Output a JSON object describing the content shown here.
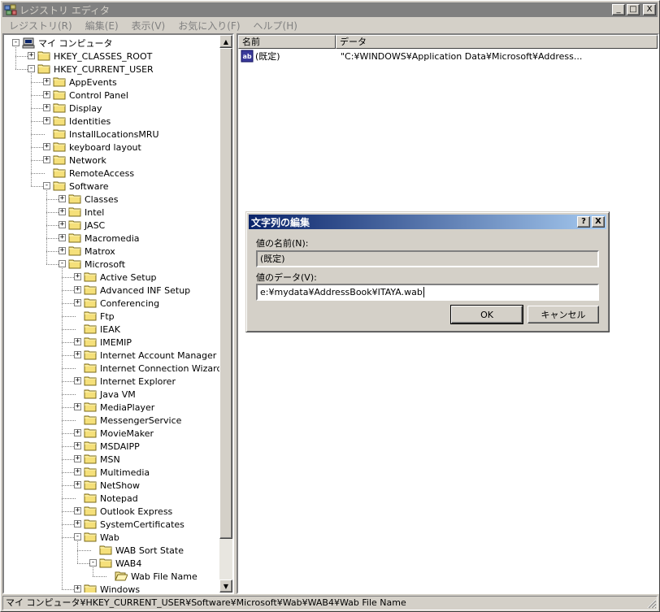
{
  "window": {
    "title": "レジストリ エディタ",
    "caption_minimize": "_",
    "caption_maximize": "□",
    "caption_close": "X"
  },
  "menu": [
    "レジストリ(R)",
    "編集(E)",
    "表示(V)",
    "お気に入り(F)",
    "ヘルプ(H)"
  ],
  "tree": {
    "root": "マイ コンピュータ",
    "nodes": [
      {
        "label": "HKEY_CLASSES_ROOT",
        "level": 1,
        "toggle": "+"
      },
      {
        "label": "HKEY_CURRENT_USER",
        "level": 1,
        "toggle": "-"
      },
      {
        "label": "AppEvents",
        "level": 2,
        "toggle": "+"
      },
      {
        "label": "Control Panel",
        "level": 2,
        "toggle": "+"
      },
      {
        "label": "Display",
        "level": 2,
        "toggle": "+"
      },
      {
        "label": "Identities",
        "level": 2,
        "toggle": "+"
      },
      {
        "label": "InstallLocationsMRU",
        "level": 2,
        "toggle": ""
      },
      {
        "label": "keyboard layout",
        "level": 2,
        "toggle": "+"
      },
      {
        "label": "Network",
        "level": 2,
        "toggle": "+"
      },
      {
        "label": "RemoteAccess",
        "level": 2,
        "toggle": ""
      },
      {
        "label": "Software",
        "level": 2,
        "toggle": "-"
      },
      {
        "label": "Classes",
        "level": 3,
        "toggle": "+"
      },
      {
        "label": "Intel",
        "level": 3,
        "toggle": "+"
      },
      {
        "label": "JASC",
        "level": 3,
        "toggle": "+"
      },
      {
        "label": "Macromedia",
        "level": 3,
        "toggle": "+"
      },
      {
        "label": "Matrox",
        "level": 3,
        "toggle": "+"
      },
      {
        "label": "Microsoft",
        "level": 3,
        "toggle": "-"
      },
      {
        "label": "Active Setup",
        "level": 4,
        "toggle": "+"
      },
      {
        "label": "Advanced INF Setup",
        "level": 4,
        "toggle": "+"
      },
      {
        "label": "Conferencing",
        "level": 4,
        "toggle": "+"
      },
      {
        "label": "Ftp",
        "level": 4,
        "toggle": ""
      },
      {
        "label": "IEAK",
        "level": 4,
        "toggle": ""
      },
      {
        "label": "IMEMIP",
        "level": 4,
        "toggle": "+"
      },
      {
        "label": "Internet Account Manager",
        "level": 4,
        "toggle": "+"
      },
      {
        "label": "Internet Connection Wizard",
        "level": 4,
        "toggle": ""
      },
      {
        "label": "Internet Explorer",
        "level": 4,
        "toggle": "+"
      },
      {
        "label": "Java VM",
        "level": 4,
        "toggle": ""
      },
      {
        "label": "MediaPlayer",
        "level": 4,
        "toggle": "+"
      },
      {
        "label": "MessengerService",
        "level": 4,
        "toggle": ""
      },
      {
        "label": "MovieMaker",
        "level": 4,
        "toggle": "+"
      },
      {
        "label": "MSDAIPP",
        "level": 4,
        "toggle": "+"
      },
      {
        "label": "MSN",
        "level": 4,
        "toggle": "+"
      },
      {
        "label": "Multimedia",
        "level": 4,
        "toggle": "+"
      },
      {
        "label": "NetShow",
        "level": 4,
        "toggle": "+"
      },
      {
        "label": "Notepad",
        "level": 4,
        "toggle": ""
      },
      {
        "label": "Outlook Express",
        "level": 4,
        "toggle": "+"
      },
      {
        "label": "SystemCertificates",
        "level": 4,
        "toggle": "+"
      },
      {
        "label": "Wab",
        "level": 4,
        "toggle": "-"
      },
      {
        "label": "WAB Sort State",
        "level": 5,
        "toggle": ""
      },
      {
        "label": "WAB4",
        "level": 5,
        "toggle": "-"
      },
      {
        "label": "Wab File Name",
        "level": 6,
        "toggle": "",
        "open": true
      },
      {
        "label": "Windows",
        "level": 4,
        "toggle": "+"
      }
    ]
  },
  "list": {
    "col_name": "名前",
    "col_data": "データ",
    "rows": [
      {
        "icon": "ab",
        "name": "(既定)",
        "data": "\"C:¥WINDOWS¥Application Data¥Microsoft¥Address..."
      }
    ]
  },
  "dialog": {
    "title": "文字列の編集",
    "help": "?",
    "close": "X",
    "name_label": "値の名前(N):",
    "name_value": "(既定)",
    "data_label": "値のデータ(V):",
    "data_value": "e:¥mydata¥AddressBook¥ITAYA.wab",
    "ok": "OK",
    "cancel": "キャンセル"
  },
  "status": "マイ コンピュータ¥HKEY_CURRENT_USER¥Software¥Microsoft¥Wab¥WAB4¥Wab File Name"
}
